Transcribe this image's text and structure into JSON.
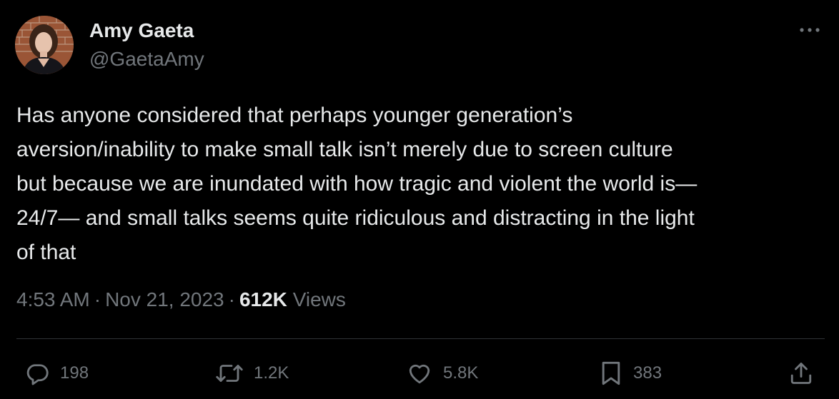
{
  "author": {
    "display_name": "Amy Gaeta",
    "handle": "@GaetaAmy",
    "avatar_icon": "profile-photo"
  },
  "tweet": {
    "text": "Has anyone considered that perhaps younger generation’s\naversion/inability to make small talk isn’t merely due to screen culture\nbut because we are inundated with how tragic and violent the world is—\n24/7— and small talks seems quite ridiculous and distracting in the light\nof that"
  },
  "meta": {
    "time": "4:53 AM",
    "separator": "·",
    "date": "Nov 21, 2023",
    "views_count": "612K",
    "views_label": "Views"
  },
  "actions": {
    "replies": "198",
    "reposts": "1.2K",
    "likes": "5.8K",
    "bookmarks": "383"
  },
  "icons": {
    "more": "more-horizontal-icon",
    "reply": "reply-icon",
    "repost": "repost-icon",
    "like": "heart-icon",
    "bookmark": "bookmark-icon",
    "share": "share-icon"
  },
  "colors": {
    "background": "#000000",
    "primary_text": "#e7e9ea",
    "secondary_text": "#71767b",
    "divider": "#2f3336"
  }
}
